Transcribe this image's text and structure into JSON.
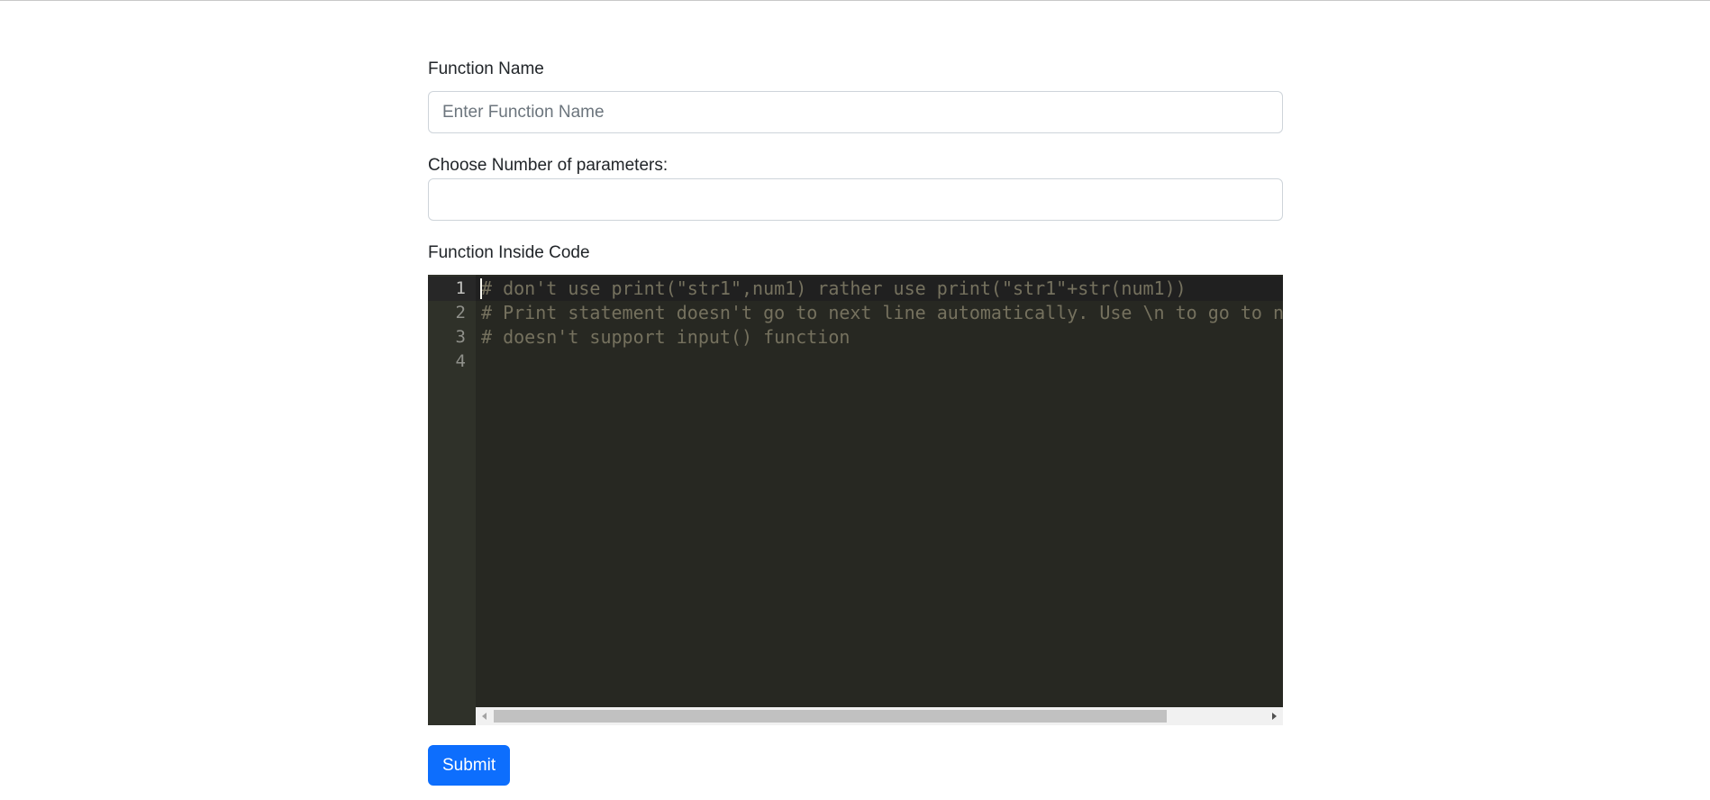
{
  "form": {
    "function_name": {
      "label": "Function Name",
      "value": "",
      "placeholder": "Enter Function Name"
    },
    "num_params": {
      "label": "Choose Number of parameters:",
      "value": ""
    },
    "code": {
      "label": "Function Inside Code",
      "line_numbers": [
        "1",
        "2",
        "3",
        "4"
      ],
      "lines": [
        "# don't use print(\"str1\",num1) rather use print(\"str1\"+str(num1))",
        "# Print statement doesn't go to next line automatically. Use \\n to go to next line",
        "# doesn't support input() function",
        ""
      ],
      "theme_colors": {
        "background": "#272822",
        "gutter": "#2f3129",
        "comment": "#75715e"
      }
    },
    "submit_label": "Submit",
    "accent_color": "#0d6efd"
  }
}
